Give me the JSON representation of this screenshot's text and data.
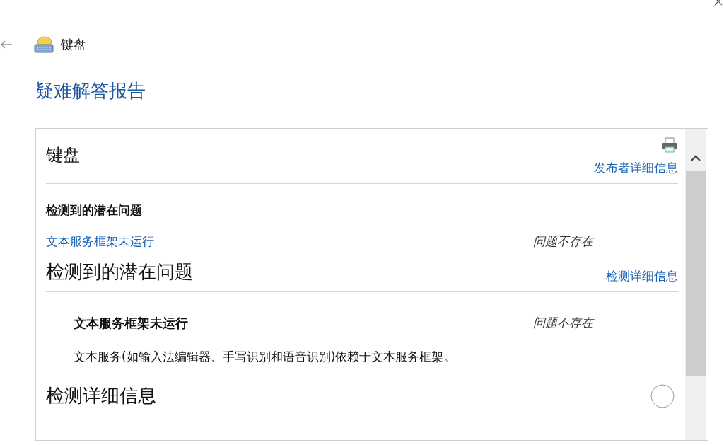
{
  "nav": {
    "title": "键盘"
  },
  "heading": "疑难解答报告",
  "report": {
    "title": "键盘",
    "publisher_link": "发布者详细信息",
    "summary": {
      "heading": "检测到的潜在问题",
      "issues": [
        {
          "name": "文本服务框架未运行",
          "status": "问题不存在"
        }
      ]
    },
    "details": {
      "heading": "检测到的潜在问题",
      "link": "检测详细信息",
      "issues": [
        {
          "name": "文本服务框架未运行",
          "status": "问题不存在",
          "description": "文本服务(如输入法编辑器、手写识别和语音识别)依赖于文本服务框架。"
        }
      ]
    },
    "next_section": {
      "heading": "检测详细信息"
    }
  }
}
